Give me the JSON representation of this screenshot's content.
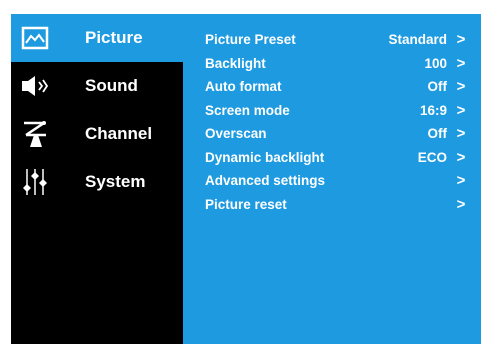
{
  "sidebar": {
    "items": [
      {
        "label": "Picture",
        "icon": "picture-icon",
        "active": true
      },
      {
        "label": "Sound",
        "icon": "speaker-icon",
        "active": false
      },
      {
        "label": "Channel",
        "icon": "antenna-icon",
        "active": false
      },
      {
        "label": "System",
        "icon": "sliders-icon",
        "active": false
      }
    ]
  },
  "settings": {
    "rows": [
      {
        "label": "Picture Preset",
        "value": "Standard",
        "chevron": ">"
      },
      {
        "label": "Backlight",
        "value": "100",
        "chevron": ">"
      },
      {
        "label": "Auto format",
        "value": "Off",
        "chevron": ">"
      },
      {
        "label": "Screen mode",
        "value": "16:9",
        "chevron": ">"
      },
      {
        "label": "Overscan",
        "value": "Off",
        "chevron": ">"
      },
      {
        "label": "Dynamic backlight",
        "value": "ECO",
        "chevron": ">"
      },
      {
        "label": "Advanced settings",
        "value": "",
        "chevron": ">"
      },
      {
        "label": "Picture reset",
        "value": "",
        "chevron": ">"
      }
    ]
  },
  "colors": {
    "accent": "#1e9be0",
    "background": "#000000",
    "text": "#ffffff"
  }
}
